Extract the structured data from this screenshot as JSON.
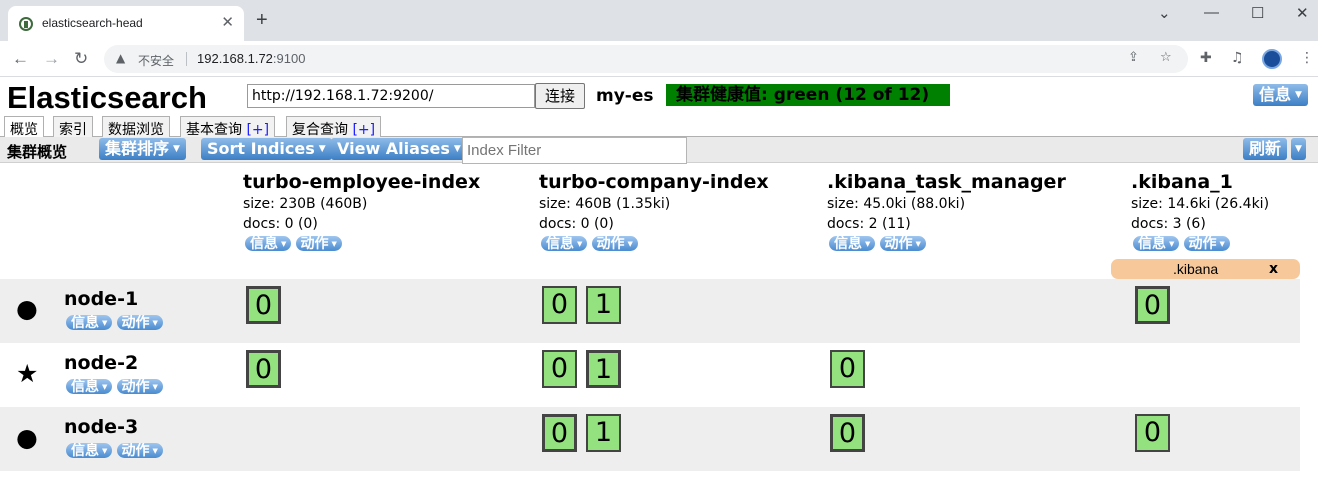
{
  "browser": {
    "tab_title": "elasticsearch-head",
    "tab_close": "✕",
    "new_tab": "+",
    "window_controls": [
      "⌄",
      "—",
      "☐",
      "✕"
    ],
    "address": {
      "security_label": "不安全",
      "host": "192.168.1.72",
      "port": ":9100"
    },
    "nav": {
      "back": "←",
      "forward": "→",
      "reload": "↻"
    }
  },
  "header": {
    "logo": "Elasticsearch",
    "connect_url": "http://192.168.1.72:9200/",
    "connect_button": "连接",
    "cluster_name": "my-es",
    "health_text": "集群健康值: green (12 of 12)",
    "health_color": "#008000",
    "info_button": "信息"
  },
  "tabs": [
    {
      "label": "概览",
      "plus": ""
    },
    {
      "label": "索引",
      "plus": ""
    },
    {
      "label": "数据浏览",
      "plus": ""
    },
    {
      "label": "基本查询 ",
      "plus": "[+]"
    },
    {
      "label": "复合查询 ",
      "plus": "[+]"
    }
  ],
  "subbar": {
    "title": "集群概览",
    "sort_cluster": "集群排序",
    "sort_indices": "Sort Indices",
    "view_aliases": "View Aliases",
    "filter_placeholder": "Index Filter",
    "refresh": "刷新"
  },
  "indices": [
    {
      "name": "turbo-employee-index",
      "size": "size: 230B (460B)",
      "docs": "docs: 0 (0)",
      "info": "信息",
      "action": "动作"
    },
    {
      "name": "turbo-company-index",
      "size": "size: 460B (1.35ki)",
      "docs": "docs: 0 (0)",
      "info": "信息",
      "action": "动作"
    },
    {
      "name": ".kibana_task_manager",
      "size": "size: 45.0ki (88.0ki)",
      "docs": "docs: 2 (11)",
      "info": "信息",
      "action": "动作"
    },
    {
      "name": ".kibana_1",
      "size": "size: 14.6ki (26.4ki)",
      "docs": "docs: 3 (6)",
      "info": "信息",
      "action": "动作"
    }
  ],
  "alias": {
    "name": ".kibana",
    "close": "x"
  },
  "nodes": [
    {
      "name": "node-1",
      "icon": "●",
      "icon_name": "circle-icon",
      "info": "信息",
      "action": "动作"
    },
    {
      "name": "node-2",
      "icon": "★",
      "icon_name": "star-icon",
      "info": "信息",
      "action": "动作"
    },
    {
      "name": "node-3",
      "icon": "●",
      "icon_name": "circle-icon",
      "info": "信息",
      "action": "动作"
    }
  ],
  "shards": {
    "node_1": {
      "employee": [
        "0"
      ],
      "company": [
        "0",
        "1"
      ],
      "task_manager": [],
      "kibana": [
        "0"
      ]
    },
    "node_2": {
      "employee": [
        "0"
      ],
      "company": [
        "0",
        "1"
      ],
      "task_manager": [
        "0"
      ],
      "kibana": []
    },
    "node_3": {
      "employee": [],
      "company": [
        "0",
        "1"
      ],
      "task_manager": [
        "0"
      ],
      "kibana": [
        "0"
      ]
    }
  },
  "colors": {
    "shard_fill": "#93e17f",
    "button_blue": "#3c7fc6",
    "alias_fill": "#f7c99a"
  }
}
